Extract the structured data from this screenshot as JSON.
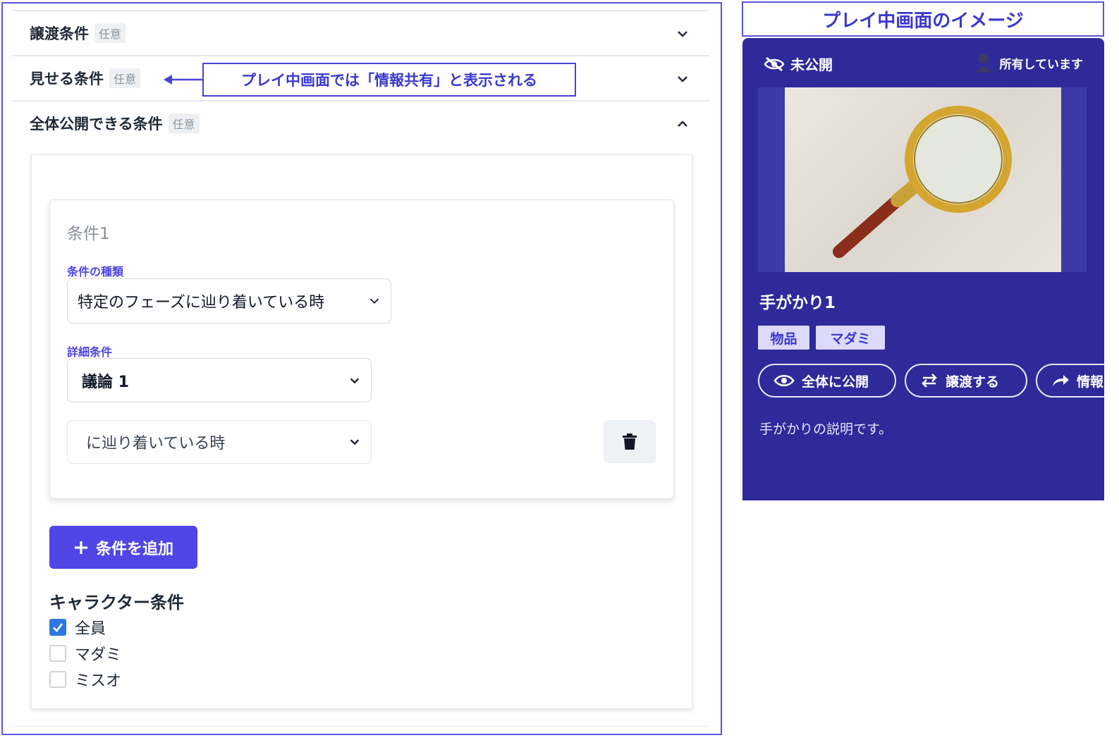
{
  "accordion": {
    "transfer": {
      "title": "譲渡条件",
      "badge": "任意"
    },
    "show": {
      "title": "見せる条件",
      "badge": "任意"
    },
    "public": {
      "title": "全体公開できる条件",
      "badge": "任意"
    }
  },
  "callout": {
    "text": "プレイ中画面では「情報共有」と表示される"
  },
  "condition": {
    "title": "条件1",
    "type_label": "条件の種類",
    "type_value": "特定のフェーズに辿り着いている時",
    "detail_label": "詳細条件",
    "detail_value": "議論 1",
    "timing_value": "に辿り着いている時"
  },
  "add_button": {
    "label": "条件を追加"
  },
  "character": {
    "title": "キャラクター条件",
    "options": [
      {
        "label": "全員",
        "checked": true
      },
      {
        "label": "マダミ",
        "checked": false
      },
      {
        "label": "ミスオ",
        "checked": false
      }
    ]
  },
  "mock": {
    "title": "プレイ中画面のイメージ",
    "status": "未公開",
    "owner": "所有しています",
    "clue_name": "手がかり1",
    "tags": [
      "物品",
      "マダミ"
    ],
    "actions": {
      "public": "全体に公開",
      "transfer": "譲渡する",
      "share": "情報"
    },
    "description": "手がかりの説明です。"
  },
  "colors": {
    "accent": "#4f46e5",
    "phone_bg": "#2e2a9a",
    "tag_bg": "#dcd9fb"
  }
}
